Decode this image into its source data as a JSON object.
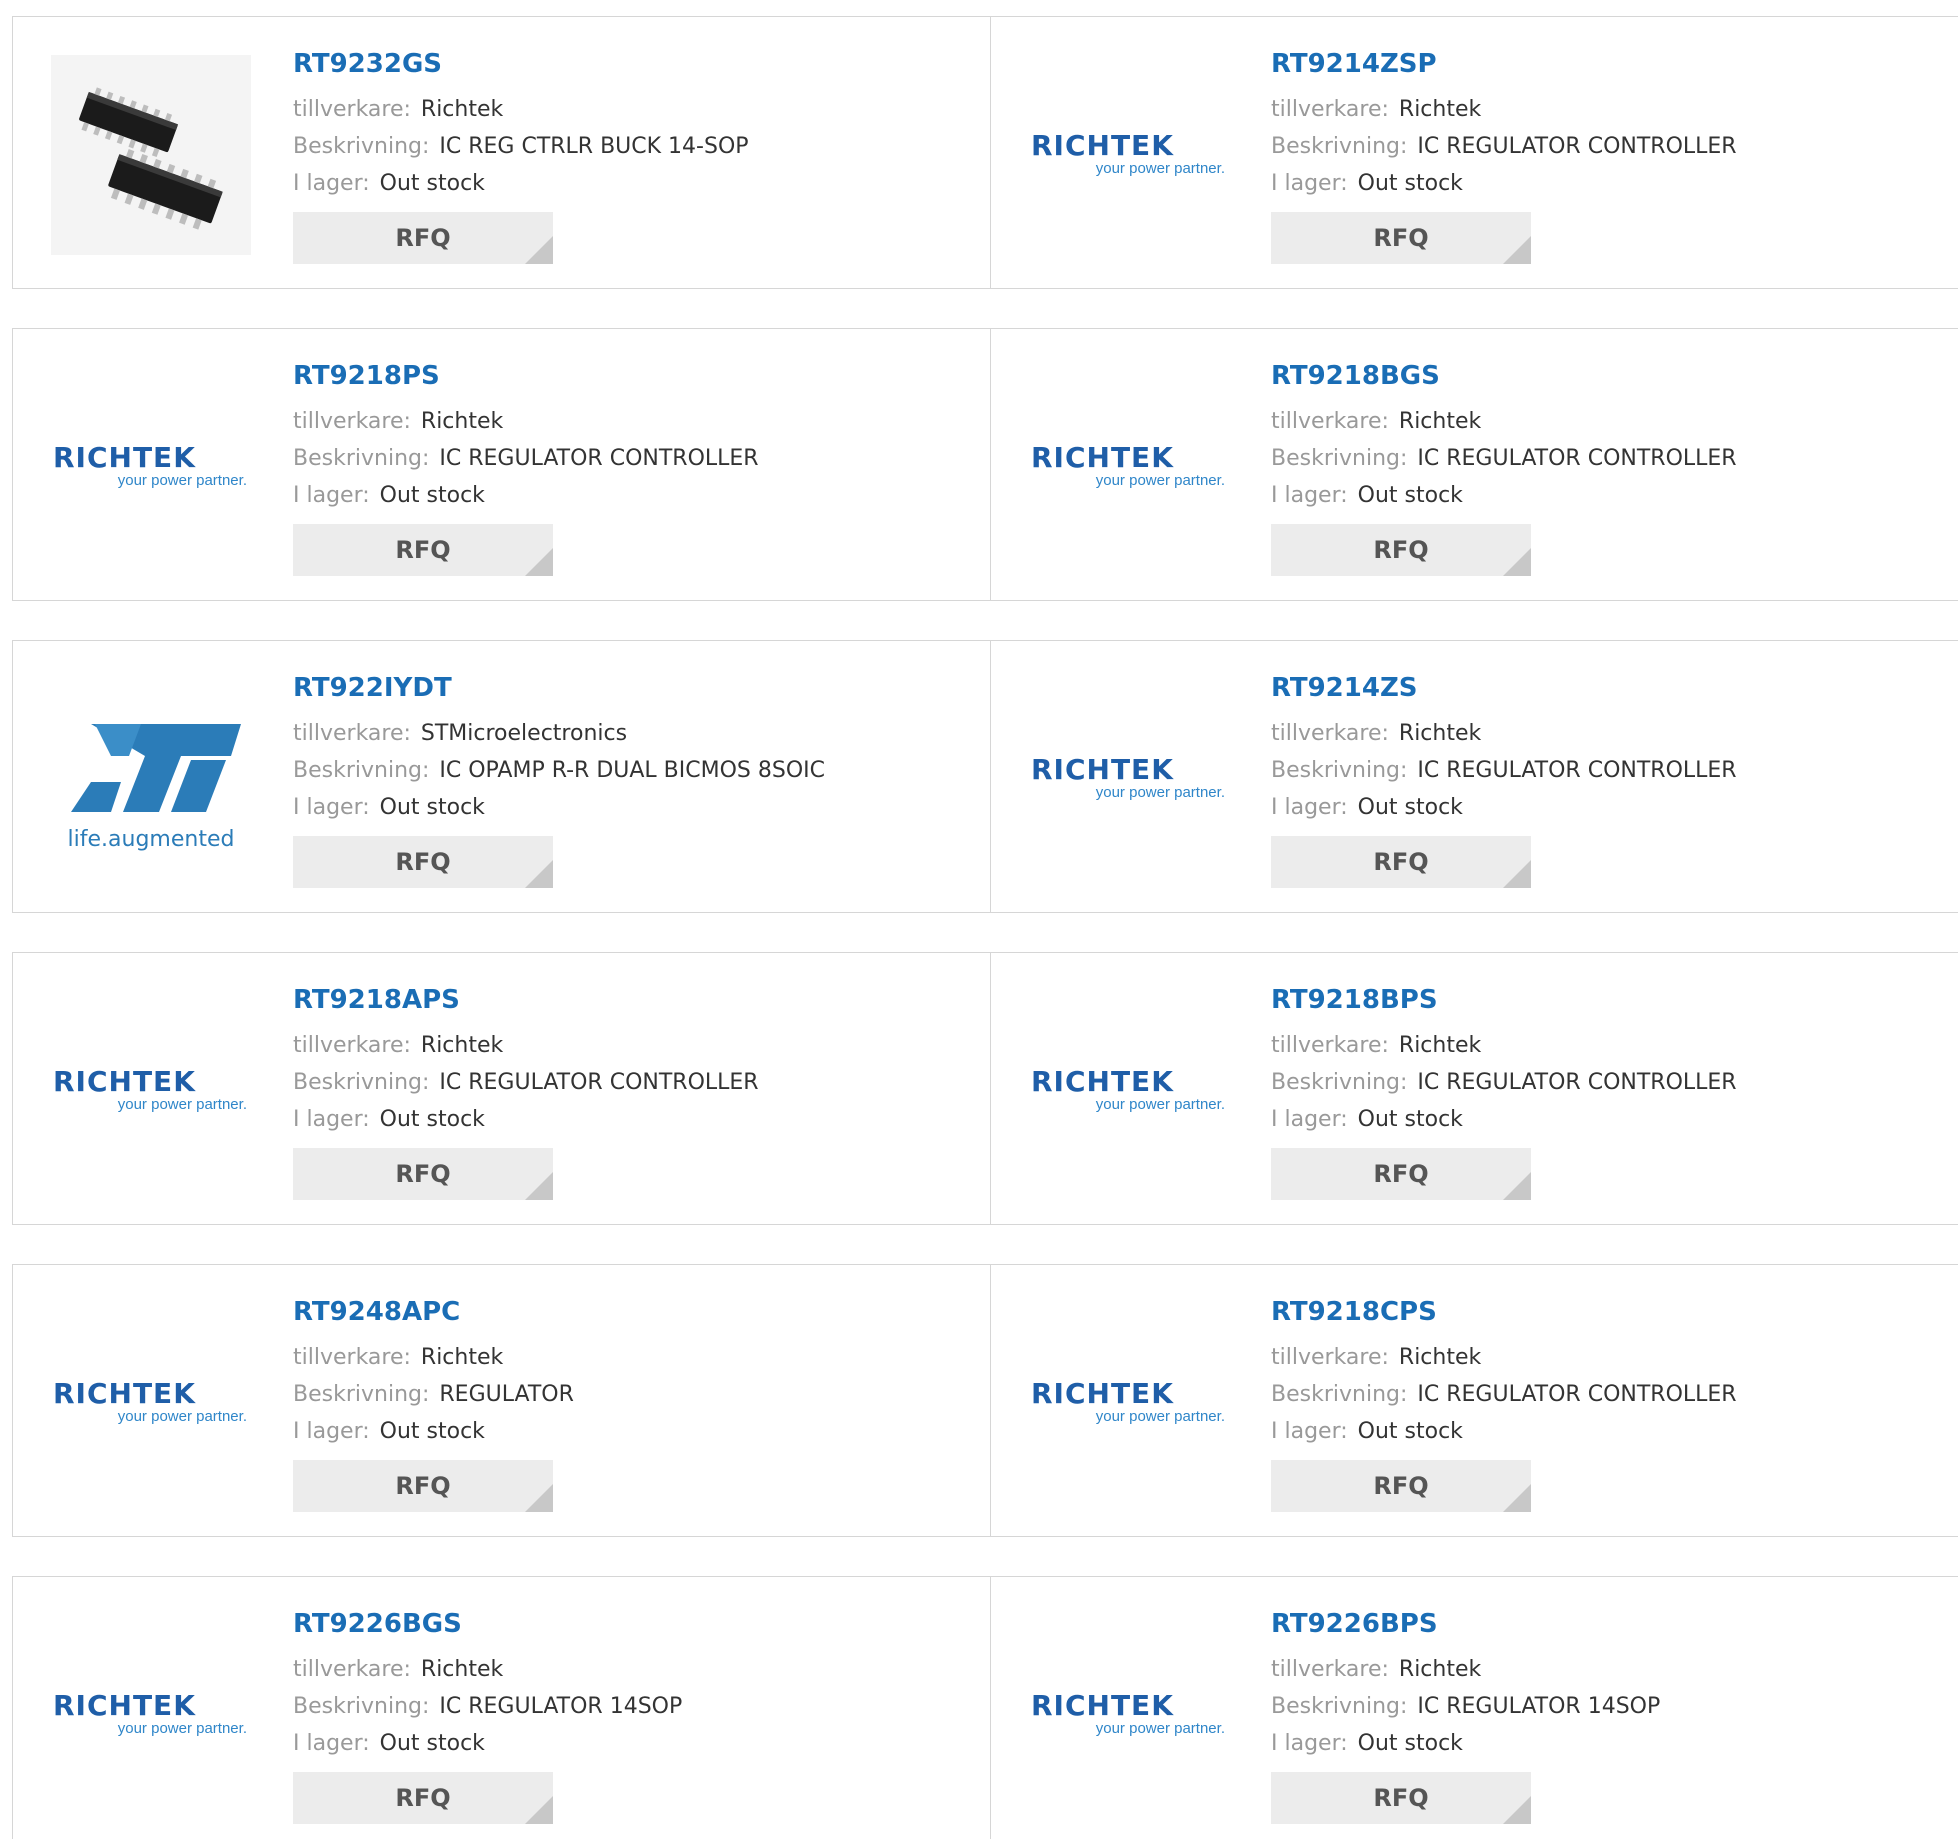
{
  "labels": {
    "manufacturer": "tillverkare:",
    "description": "Beskrivning:",
    "stock": "I lager:",
    "rfq": "RFQ"
  },
  "logos": {
    "richtek_name": "RICHTEK",
    "richtek_tagline": "your power partner.",
    "st_tagline": "life.augmented"
  },
  "colors": {
    "link": "#1a6db5",
    "label": "#999999",
    "rfq_bg": "#ececec",
    "richtek_blue": "#1f5ea8",
    "st_blue": "#2b7cb8"
  },
  "products": [
    {
      "part": "RT9232GS",
      "manufacturer": "Richtek",
      "description": "IC REG CTRLR BUCK 14-SOP",
      "stock": "Out stock",
      "image": "chip-photo"
    },
    {
      "part": "RT9214ZSP",
      "manufacturer": "Richtek",
      "description": "IC REGULATOR CONTROLLER",
      "stock": "Out stock",
      "image": "richtek-logo"
    },
    {
      "part": "RT9218PS",
      "manufacturer": "Richtek",
      "description": "IC REGULATOR CONTROLLER",
      "stock": "Out stock",
      "image": "richtek-logo"
    },
    {
      "part": "RT9218BGS",
      "manufacturer": "Richtek",
      "description": "IC REGULATOR CONTROLLER",
      "stock": "Out stock",
      "image": "richtek-logo"
    },
    {
      "part": "RT922IYDT",
      "manufacturer": "STMicroelectronics",
      "description": "IC OPAMP R-R DUAL BICMOS 8SOIC",
      "stock": "Out stock",
      "image": "st-logo"
    },
    {
      "part": "RT9214ZS",
      "manufacturer": "Richtek",
      "description": "IC REGULATOR CONTROLLER",
      "stock": "Out stock",
      "image": "richtek-logo"
    },
    {
      "part": "RT9218APS",
      "manufacturer": "Richtek",
      "description": "IC REGULATOR CONTROLLER",
      "stock": "Out stock",
      "image": "richtek-logo"
    },
    {
      "part": "RT9218BPS",
      "manufacturer": "Richtek",
      "description": "IC REGULATOR CONTROLLER",
      "stock": "Out stock",
      "image": "richtek-logo"
    },
    {
      "part": "RT9248APC",
      "manufacturer": "Richtek",
      "description": "REGULATOR",
      "stock": "Out stock",
      "image": "richtek-logo"
    },
    {
      "part": "RT9218CPS",
      "manufacturer": "Richtek",
      "description": "IC REGULATOR CONTROLLER",
      "stock": "Out stock",
      "image": "richtek-logo"
    },
    {
      "part": "RT9226BGS",
      "manufacturer": "Richtek",
      "description": "IC REGULATOR 14SOP",
      "stock": "Out stock",
      "image": "richtek-logo"
    },
    {
      "part": "RT9226BPS",
      "manufacturer": "Richtek",
      "description": "IC REGULATOR 14SOP",
      "stock": "Out stock",
      "image": "richtek-logo"
    }
  ]
}
